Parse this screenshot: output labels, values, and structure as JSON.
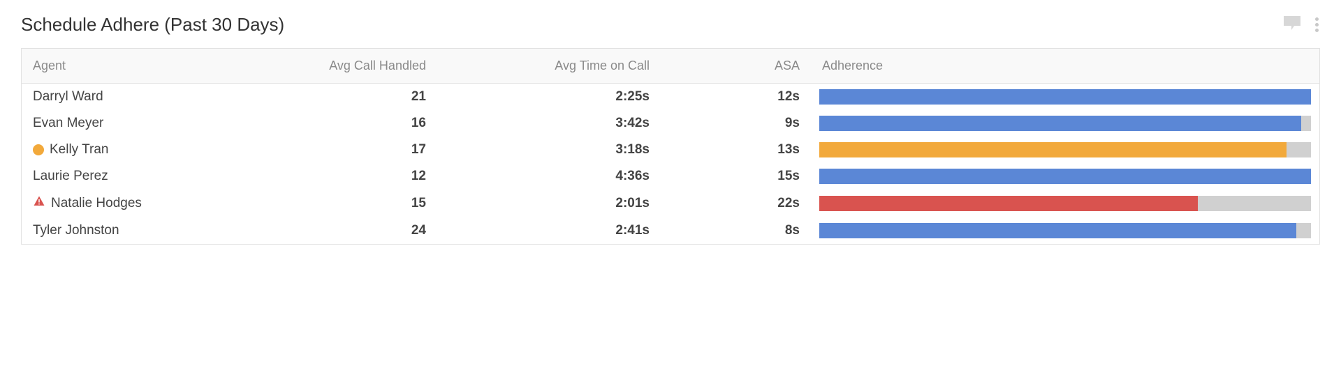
{
  "title": "Schedule Adhere (Past 30 Days)",
  "icons": {
    "comment": "comment-icon",
    "menu": "kebab-menu-icon"
  },
  "columns": {
    "agent": "Agent",
    "avg_call_handled": "Avg Call Handled",
    "avg_time_on_call": "Avg Time on Call",
    "asa": "ASA",
    "adherence": "Adherence"
  },
  "colors": {
    "blue": "#5b87d6",
    "orange": "#f2a93b",
    "red": "#d9534f",
    "track": "#d0d0d0"
  },
  "rows": [
    {
      "agent": "Darryl Ward",
      "status": null,
      "avg_call_handled": "21",
      "avg_time_on_call": "2:25s",
      "asa": "12s",
      "adherence_pct": 100,
      "adherence_color": "blue"
    },
    {
      "agent": "Evan Meyer",
      "status": null,
      "avg_call_handled": "16",
      "avg_time_on_call": "3:42s",
      "asa": "9s",
      "adherence_pct": 98,
      "adherence_color": "blue"
    },
    {
      "agent": "Kelly Tran",
      "status": "warning",
      "avg_call_handled": "17",
      "avg_time_on_call": "3:18s",
      "asa": "13s",
      "adherence_pct": 95,
      "adherence_color": "orange"
    },
    {
      "agent": "Laurie Perez",
      "status": null,
      "avg_call_handled": "12",
      "avg_time_on_call": "4:36s",
      "asa": "15s",
      "adherence_pct": 100,
      "adherence_color": "blue"
    },
    {
      "agent": "Natalie Hodges",
      "status": "alert",
      "avg_call_handled": "15",
      "avg_time_on_call": "2:01s",
      "asa": "22s",
      "adherence_pct": 77,
      "adherence_color": "red"
    },
    {
      "agent": "Tyler Johnston",
      "status": null,
      "avg_call_handled": "24",
      "avg_time_on_call": "2:41s",
      "asa": "8s",
      "adherence_pct": 97,
      "adherence_color": "blue"
    }
  ]
}
